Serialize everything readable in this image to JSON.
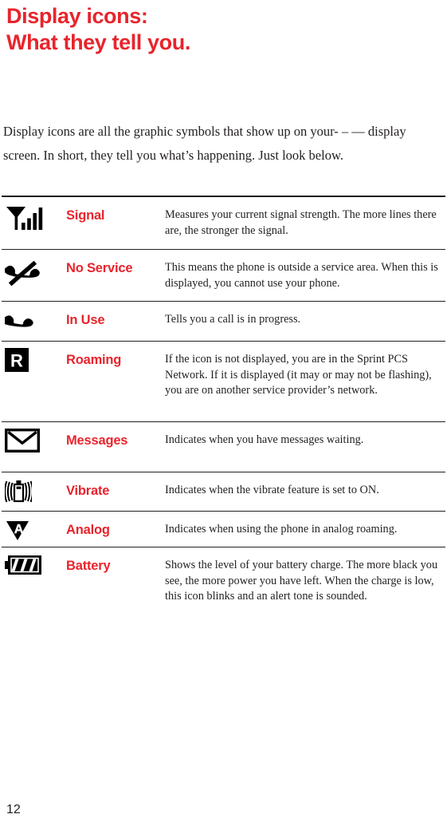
{
  "heading": {
    "line1": "Display icons:",
    "line2": "What they tell you.",
    "color": "#e8242c"
  },
  "intro": {
    "text": "Display icons are all the graphic symbols that show up on your- – — display screen. In short, they tell you what’s happening. Just look below."
  },
  "table": {
    "rows": [
      {
        "icon": "signal-bars-icon",
        "label": "Signal",
        "description": "Measures your current signal strength. The more lines there are, the stronger the signal."
      },
      {
        "icon": "no-service-phone-slash-icon",
        "label": "No Service",
        "description": "This means the phone is outside a service area. When this is displayed, you cannot use your phone."
      },
      {
        "icon": "in-use-handset-icon",
        "label": "In Use",
        "description": "Tells you a call is in progress."
      },
      {
        "icon": "roaming-r-icon",
        "label": "Roaming",
        "description": "If the icon is not displayed, you are in the Sprint PCS Network. If it is displayed (it may or may not be flashing), you are on another service provider’s network."
      },
      {
        "icon": "messages-envelope-icon",
        "label": "Messages",
        "description": "Indicates when you have messages waiting."
      },
      {
        "icon": "vibrate-phone-icon",
        "label": "Vibrate",
        "description": "Indicates when the vibrate feature is set to ON."
      },
      {
        "icon": "analog-triangle-a-icon",
        "label": "Analog",
        "description": "Indicates when using the phone in analog roaming."
      },
      {
        "icon": "battery-level-icon",
        "label": "Battery",
        "description": "Shows the level of your battery charge. The more black you see, the more power you have left. When the charge is low, this icon blinks and an alert tone is sounded."
      }
    ]
  },
  "footer": {
    "page_number": "12"
  }
}
